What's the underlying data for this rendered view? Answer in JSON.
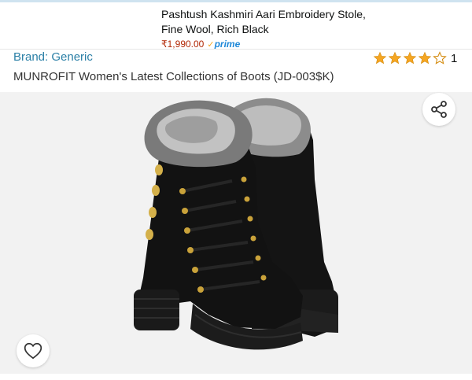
{
  "ad": {
    "title_line1": "Pashtush Kashmiri Aari Embroidery Stole,",
    "title_line2": "Fine Wool, Rich Black",
    "price": "₹1,990.00",
    "prime_label": "prime"
  },
  "product": {
    "brand": "Brand: Generic",
    "title": "MUNROFIT Women's Latest Collections of Boots (JD-003$K)",
    "rating": 4,
    "rating_count": "1"
  },
  "icons": {
    "share": "share-icon",
    "wishlist": "heart-icon",
    "star": "star-icon"
  },
  "colors": {
    "price": "#b12704",
    "link": "#2a7fa6",
    "star": "#f5a623",
    "prime": "#1f88d8"
  }
}
